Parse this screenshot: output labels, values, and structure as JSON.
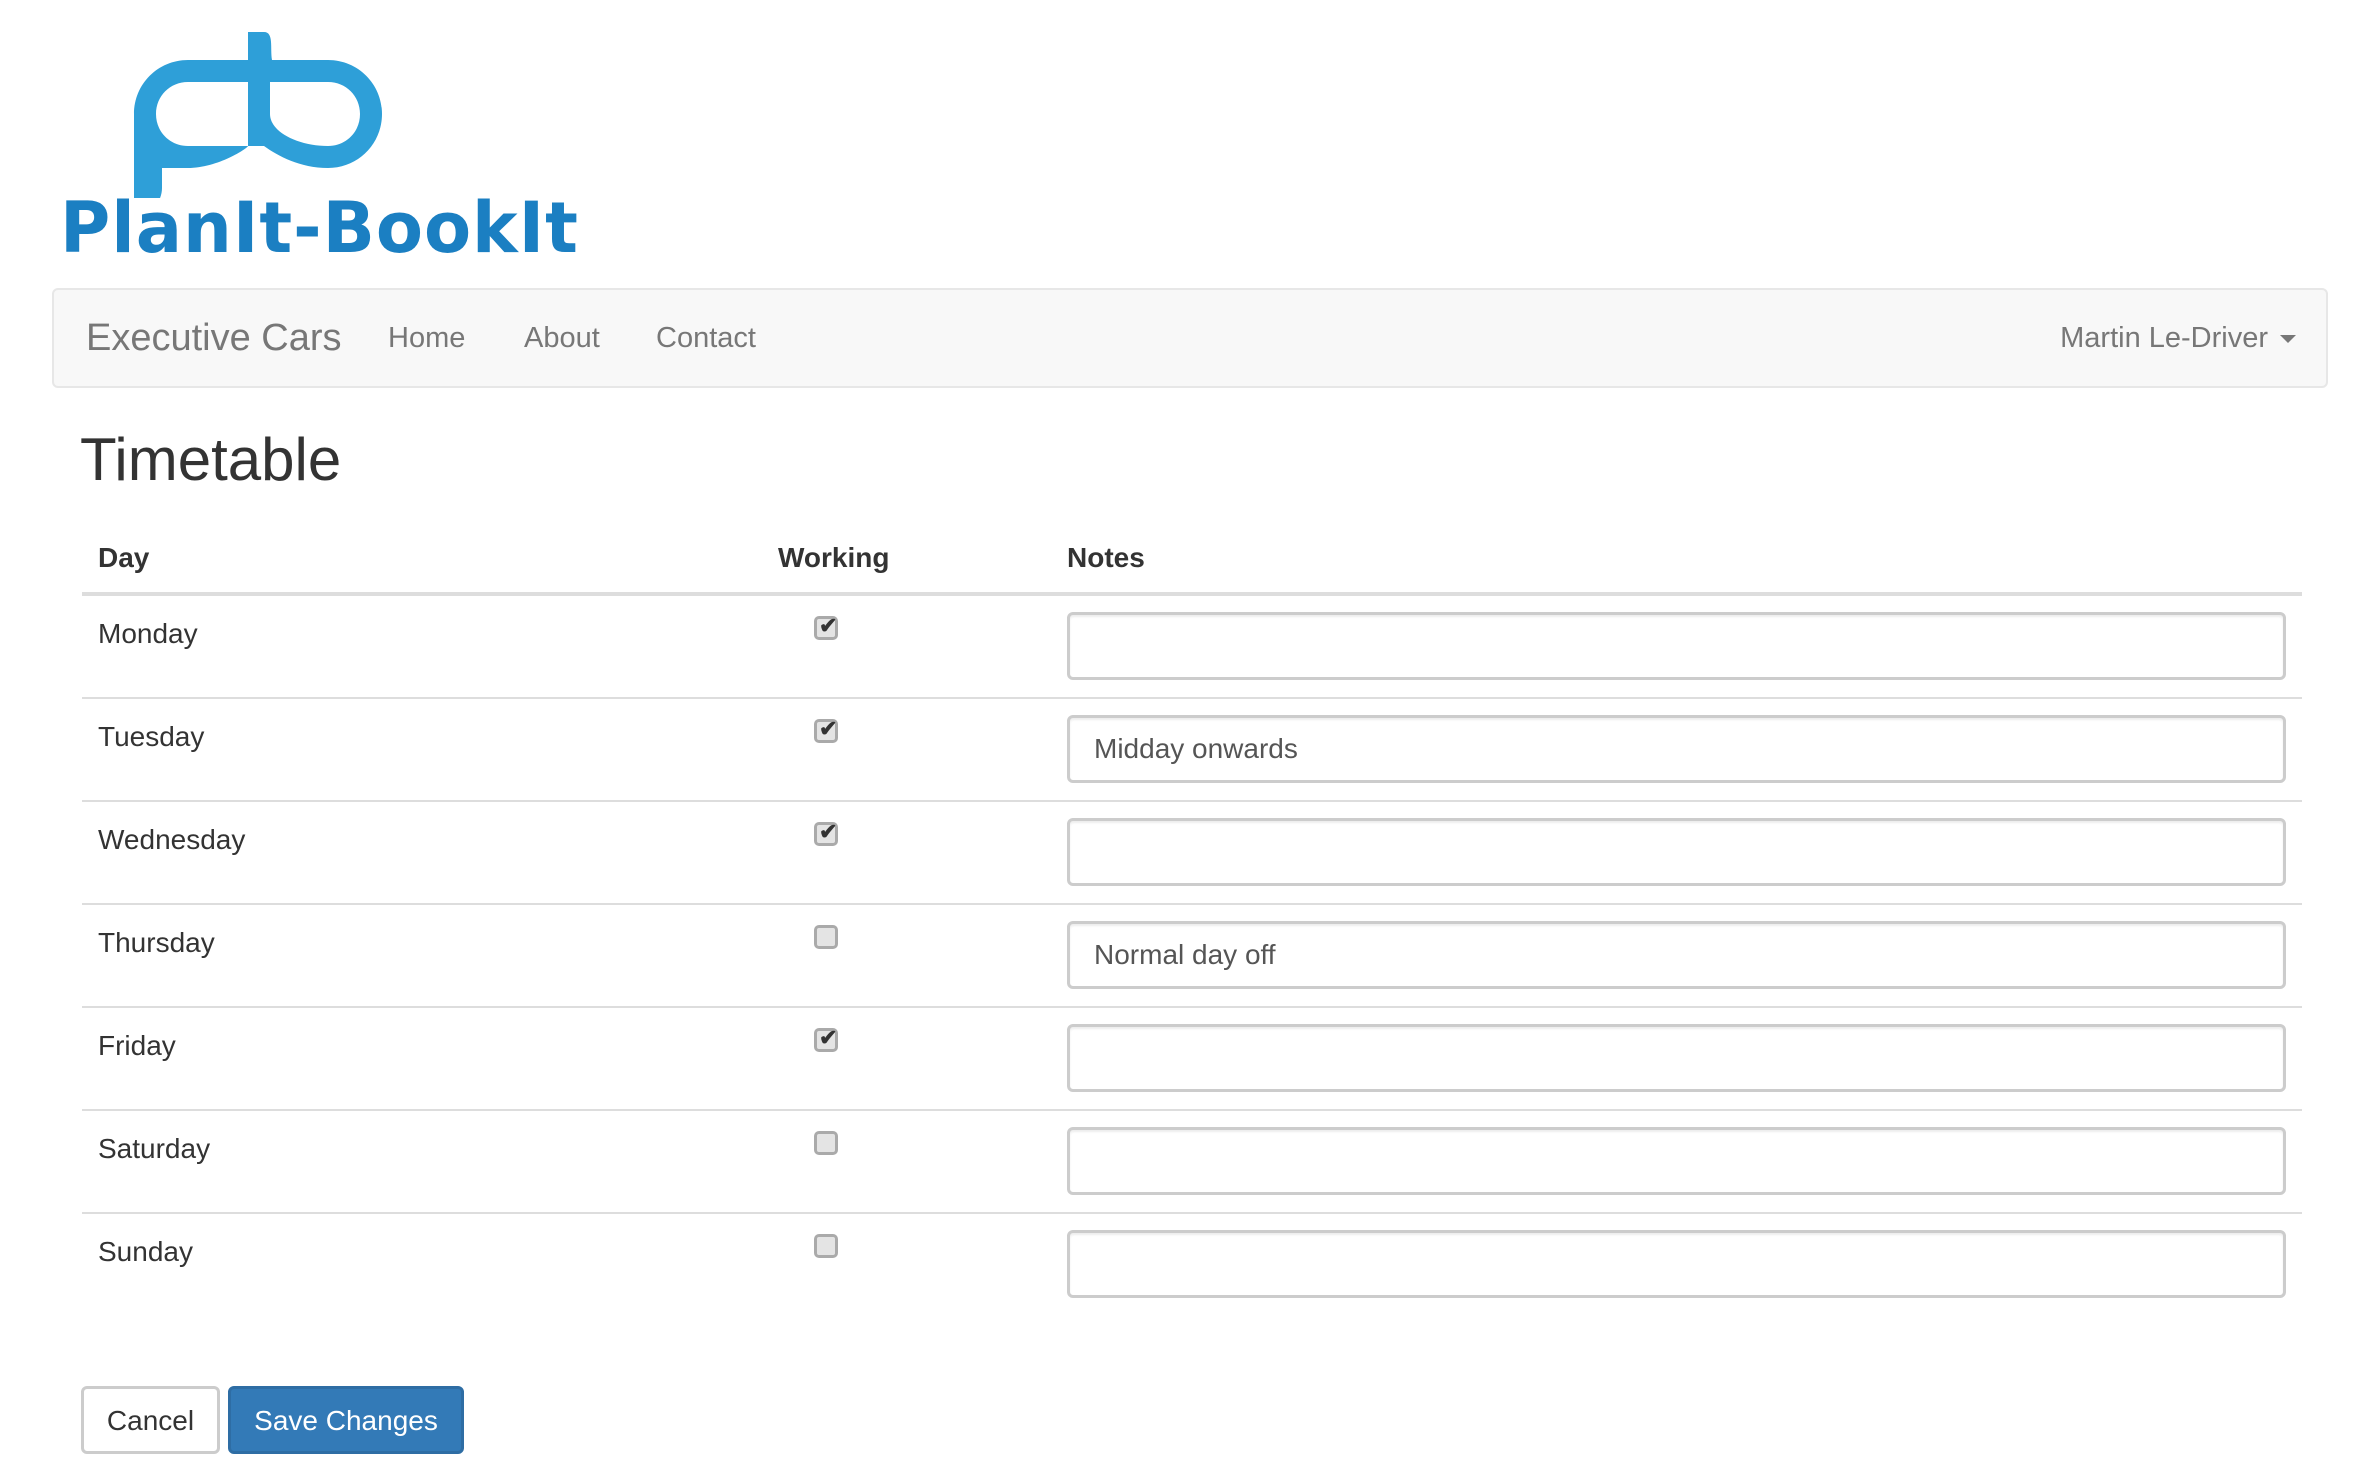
{
  "logo": {
    "text": "PlanIt-BookIt",
    "icon": "pb-monogram-icon",
    "icon_color": "#2e9fd8",
    "text_color": "#1b7fc2"
  },
  "navbar": {
    "brand": "Executive Cars",
    "links": [
      {
        "label": "Home"
      },
      {
        "label": "About"
      },
      {
        "label": "Contact"
      }
    ],
    "user_menu": {
      "label": "Martin Le-Driver",
      "icon": "caret-down-icon"
    }
  },
  "page": {
    "title": "Timetable"
  },
  "timetable": {
    "headers": {
      "day": "Day",
      "working": "Working",
      "notes": "Notes"
    },
    "rows": [
      {
        "day": "Monday",
        "working": true,
        "notes": ""
      },
      {
        "day": "Tuesday",
        "working": true,
        "notes": "Midday onwards"
      },
      {
        "day": "Wednesday",
        "working": true,
        "notes": ""
      },
      {
        "day": "Thursday",
        "working": false,
        "notes": "Normal day off"
      },
      {
        "day": "Friday",
        "working": true,
        "notes": ""
      },
      {
        "day": "Saturday",
        "working": false,
        "notes": ""
      },
      {
        "day": "Sunday",
        "working": false,
        "notes": ""
      }
    ]
  },
  "actions": {
    "cancel_label": "Cancel",
    "save_label": "Save Changes",
    "save_color": "#337ab7"
  }
}
